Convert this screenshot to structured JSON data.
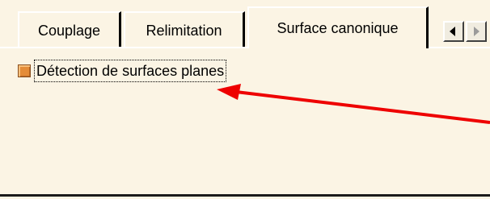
{
  "tabs": [
    {
      "label": "Couplage",
      "selected": false
    },
    {
      "label": "Relimitation",
      "selected": false
    },
    {
      "label": "Surface canonique",
      "selected": true
    }
  ],
  "panel": {
    "checkbox": {
      "label": "Détection de surfaces planes",
      "checked": true,
      "color": "#e48c38"
    }
  },
  "annotation": {
    "arrow_color": "#ee0000"
  },
  "icons": {
    "scroll_left": "triangle-left",
    "scroll_right": "triangle-right"
  }
}
